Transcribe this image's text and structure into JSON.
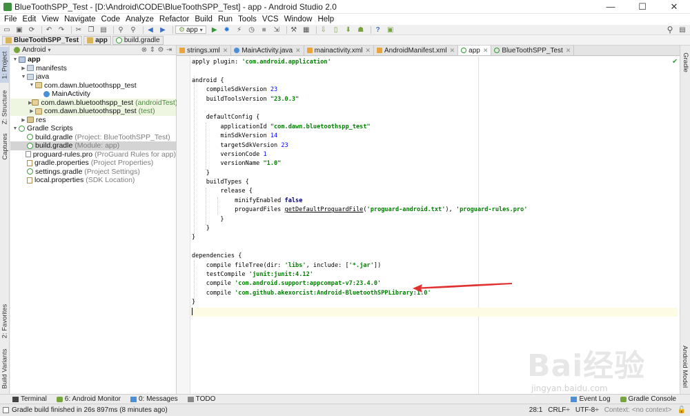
{
  "window": {
    "title": "BlueToothSPP_Test - [D:\\Android\\CODE\\BlueToothSPP_Test] - app - Android Studio 2.0",
    "controls": {
      "minimize": "—",
      "maximize": "☐",
      "close": "✕"
    }
  },
  "menu": [
    "File",
    "Edit",
    "View",
    "Navigate",
    "Code",
    "Analyze",
    "Refactor",
    "Build",
    "Run",
    "Tools",
    "VCS",
    "Window",
    "Help"
  ],
  "toolbar": {
    "run_config": "app"
  },
  "breadcrumbs": [
    "BlueToothSPP_Test",
    "app",
    "build.gradle"
  ],
  "left_stripe": {
    "project": "1: Project",
    "structure": "Z: Structure",
    "captures": "Captures",
    "favorites": "2: Favorites",
    "build_variants": "Build Variants"
  },
  "right_stripe": {
    "gradle": "Gradle",
    "android_model": "Android Model"
  },
  "project_panel": {
    "view_selector": "Android",
    "tree": [
      {
        "label": "app",
        "sub": "",
        "indent": 0,
        "icon": "mod",
        "arrow": "▼",
        "bold": true
      },
      {
        "label": "manifests",
        "sub": "",
        "indent": 1,
        "icon": "folder",
        "arrow": "▶"
      },
      {
        "label": "java",
        "sub": "",
        "indent": 1,
        "icon": "folder",
        "arrow": "▼"
      },
      {
        "label": "com.dawn.bluetoothspp_test",
        "sub": "",
        "indent": 2,
        "icon": "pkg",
        "arrow": "▼"
      },
      {
        "label": "MainActivity",
        "sub": "",
        "indent": 3,
        "icon": "cls",
        "arrow": ""
      },
      {
        "label": "com.dawn.bluetoothspp_test",
        "sub": "(androidTest)",
        "indent": 2,
        "icon": "pkg",
        "arrow": "▶",
        "hl": true
      },
      {
        "label": "com.dawn.bluetoothspp_test",
        "sub": "(test)",
        "indent": 2,
        "icon": "pkg",
        "arrow": "▶",
        "hl": true
      },
      {
        "label": "res",
        "sub": "",
        "indent": 1,
        "icon": "res",
        "arrow": "▶"
      },
      {
        "label": "Gradle Scripts",
        "sub": "",
        "indent": 0,
        "icon": "grd",
        "arrow": "▼"
      },
      {
        "label": "build.gradle",
        "sub": "(Project: BlueToothSPP_Test)",
        "indent": 1,
        "icon": "grd",
        "arrow": ""
      },
      {
        "label": "build.gradle",
        "sub": "(Module: app)",
        "indent": 1,
        "icon": "grd",
        "arrow": "",
        "selected": true
      },
      {
        "label": "proguard-rules.pro",
        "sub": "(ProGuard Rules for app)",
        "indent": 1,
        "icon": "file",
        "arrow": ""
      },
      {
        "label": "gradle.properties",
        "sub": "(Project Properties)",
        "indent": 1,
        "icon": "prop",
        "arrow": ""
      },
      {
        "label": "settings.gradle",
        "sub": "(Project Settings)",
        "indent": 1,
        "icon": "grd",
        "arrow": ""
      },
      {
        "label": "local.properties",
        "sub": "(SDK Location)",
        "indent": 1,
        "icon": "prop",
        "arrow": ""
      }
    ]
  },
  "editor_tabs": [
    {
      "label": "strings.xml",
      "icon": "xml",
      "active": false
    },
    {
      "label": "MainActivity.java",
      "icon": "java",
      "active": false
    },
    {
      "label": "mainactivity.xml",
      "icon": "xml",
      "active": false
    },
    {
      "label": "AndroidManifest.xml",
      "icon": "xml",
      "active": false
    },
    {
      "label": "app",
      "icon": "gr",
      "active": true
    },
    {
      "label": "BlueToothSPP_Test",
      "icon": "gr",
      "active": false
    }
  ],
  "code_lines": [
    [
      [
        "t",
        "apply plugin: "
      ],
      [
        "s",
        "'com.android.application'"
      ]
    ],
    [],
    [
      [
        "t",
        "android {"
      ]
    ],
    [
      [
        "t",
        "    compileSdkVersion "
      ],
      [
        "n",
        "23"
      ]
    ],
    [
      [
        "t",
        "    buildToolsVersion "
      ],
      [
        "s",
        "\"23.0.3\""
      ]
    ],
    [],
    [
      [
        "t",
        "    defaultConfig {"
      ]
    ],
    [
      [
        "t",
        "        applicationId "
      ],
      [
        "s",
        "\"com.dawn.bluetoothspp_test\""
      ]
    ],
    [
      [
        "t",
        "        minSdkVersion "
      ],
      [
        "n",
        "14"
      ]
    ],
    [
      [
        "t",
        "        targetSdkVersion "
      ],
      [
        "n",
        "23"
      ]
    ],
    [
      [
        "t",
        "        versionCode "
      ],
      [
        "n",
        "1"
      ]
    ],
    [
      [
        "t",
        "        versionName "
      ],
      [
        "s",
        "\"1.0\""
      ]
    ],
    [
      [
        "t",
        "    }"
      ]
    ],
    [
      [
        "t",
        "    buildTypes {"
      ]
    ],
    [
      [
        "t",
        "        release {"
      ]
    ],
    [
      [
        "t",
        "            minifyEnabled "
      ],
      [
        "k",
        "false"
      ]
    ],
    [
      [
        "t",
        "            proguardFiles "
      ],
      [
        "f",
        "getDefaultProguardFile"
      ],
      [
        "t",
        "("
      ],
      [
        "s",
        "'proguard-android.txt'"
      ],
      [
        "t",
        "), "
      ],
      [
        "s",
        "'proguard-rules.pro'"
      ]
    ],
    [
      [
        "t",
        "        }"
      ]
    ],
    [
      [
        "t",
        "    }"
      ]
    ],
    [
      [
        "t",
        "}"
      ]
    ],
    [],
    [
      [
        "t",
        "dependencies {"
      ]
    ],
    [
      [
        "t",
        "    compile fileTree(dir: "
      ],
      [
        "s",
        "'libs'"
      ],
      [
        "t",
        ", include: ["
      ],
      [
        "s",
        "'*.jar'"
      ],
      [
        "t",
        "])"
      ]
    ],
    [
      [
        "t",
        "    testCompile "
      ],
      [
        "s",
        "'junit:junit:4.12'"
      ]
    ],
    [
      [
        "t",
        "    compile "
      ],
      [
        "s",
        "'com.android.support:appcompat-v7:23.4.0'"
      ]
    ],
    [
      [
        "t",
        "    compile "
      ],
      [
        "s",
        "'com.github.akexorcist:Android-BluetoothSPPLibrary:1.0'"
      ]
    ],
    [
      [
        "t",
        "}"
      ]
    ],
    [
      [
        "caret",
        ""
      ]
    ]
  ],
  "bottom_tools": [
    {
      "label": "Terminal",
      "icon": "term"
    },
    {
      "label": "6: Android Monitor",
      "icon": "mon"
    },
    {
      "label": "0: Messages",
      "icon": "msg"
    },
    {
      "label": "TODO",
      "icon": "todo"
    }
  ],
  "bottom_tools_right": [
    "Event Log",
    "Gradle Console"
  ],
  "status": {
    "message": "Gradle build finished in 26s 897ms (8 minutes ago)",
    "position": "28:1",
    "line_sep": "CRLF÷",
    "encoding": "UTF-8÷",
    "context": "Context: <no context>"
  },
  "watermark": {
    "text": "Bai经验",
    "url": "jingyan.baidu.com"
  },
  "colors": {
    "string": "#008000",
    "number": "#0000ff",
    "keyword": "#000080",
    "arrow": "#e03030"
  }
}
